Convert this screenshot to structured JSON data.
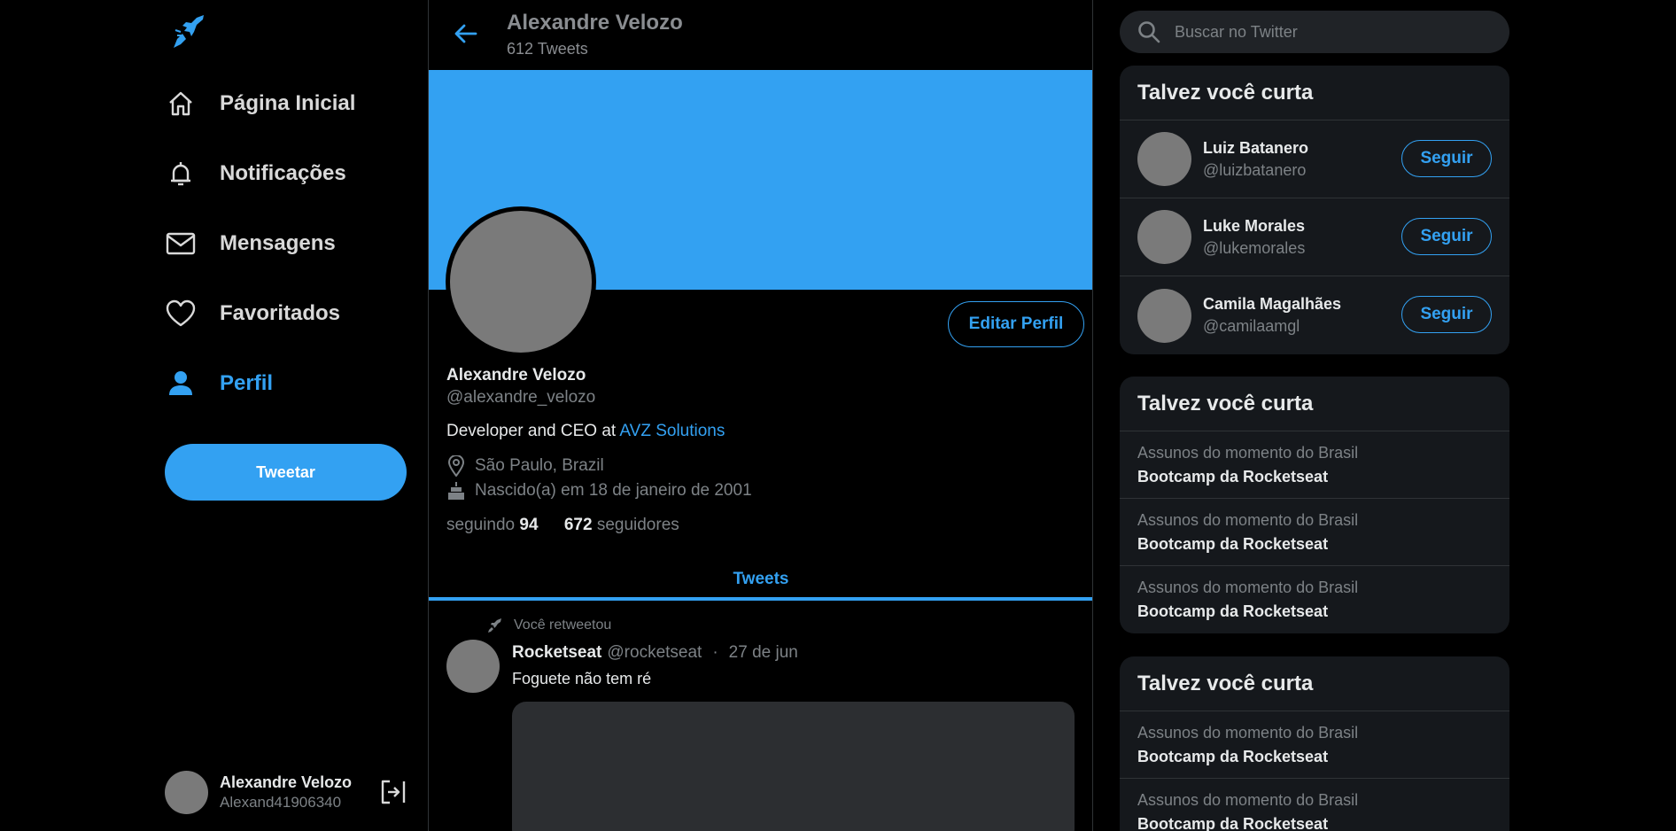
{
  "sidebar": {
    "logo_icon": "rocket-bird-icon",
    "items": [
      {
        "label": "Página Inicial",
        "icon": "home-icon"
      },
      {
        "label": "Notificações",
        "icon": "bell-icon"
      },
      {
        "label": "Mensagens",
        "icon": "mail-icon"
      },
      {
        "label": "Favoritados",
        "icon": "heart-icon"
      },
      {
        "label": "Perfil",
        "icon": "person-icon",
        "active": true
      }
    ],
    "tweet_button": "Tweetar",
    "account": {
      "name": "Alexandre Velozo",
      "handle": "Alexand41906340"
    }
  },
  "header": {
    "title": "Alexandre Velozo",
    "subtitle": "612 Tweets"
  },
  "profile": {
    "edit_button": "Editar Perfil",
    "name": "Alexandre Velozo",
    "handle": "@alexandre_velozo",
    "bio_text": "Developer and CEO at ",
    "bio_link": "AVZ Solutions",
    "location": "São Paulo, Brazil",
    "birth": "Nascido(a) em 18 de janeiro de 2001",
    "following_label": "seguindo",
    "following_count": "94",
    "followers_count": "672",
    "followers_label": "seguidores"
  },
  "tabs": {
    "tweets": "Tweets"
  },
  "tweet": {
    "retweet_label": "Você retweetou",
    "name": "Rocketseat",
    "handle": "@rocketseat",
    "separator": "·",
    "date": "27 de jun",
    "text": "Foguete não tem ré"
  },
  "right": {
    "search_placeholder": "Buscar no Twitter",
    "who_to_follow": {
      "title": "Talvez você curta",
      "follow_label": "Seguir",
      "users": [
        {
          "name": "Luiz Batanero",
          "handle": "@luizbatanero"
        },
        {
          "name": "Luke Morales",
          "handle": "@lukemorales"
        },
        {
          "name": "Camila Magalhães",
          "handle": "@camilaamgl"
        }
      ]
    },
    "trends1": {
      "title": "Talvez você curta",
      "items": [
        {
          "category": "Assunos do momento do Brasil",
          "name": "Bootcamp da Rocketseat"
        },
        {
          "category": "Assunos do momento do Brasil",
          "name": "Bootcamp da Rocketseat"
        },
        {
          "category": "Assunos do momento do Brasil",
          "name": "Bootcamp da Rocketseat"
        }
      ]
    },
    "trends2": {
      "title": "Talvez você curta",
      "items": [
        {
          "category": "Assunos do momento do Brasil",
          "name": "Bootcamp da Rocketseat"
        },
        {
          "category": "Assunos do momento do Brasil",
          "name": "Bootcamp da Rocketseat"
        }
      ]
    }
  },
  "colors": {
    "accent": "#33a1f2",
    "background": "#000000",
    "card": "#15181c"
  }
}
